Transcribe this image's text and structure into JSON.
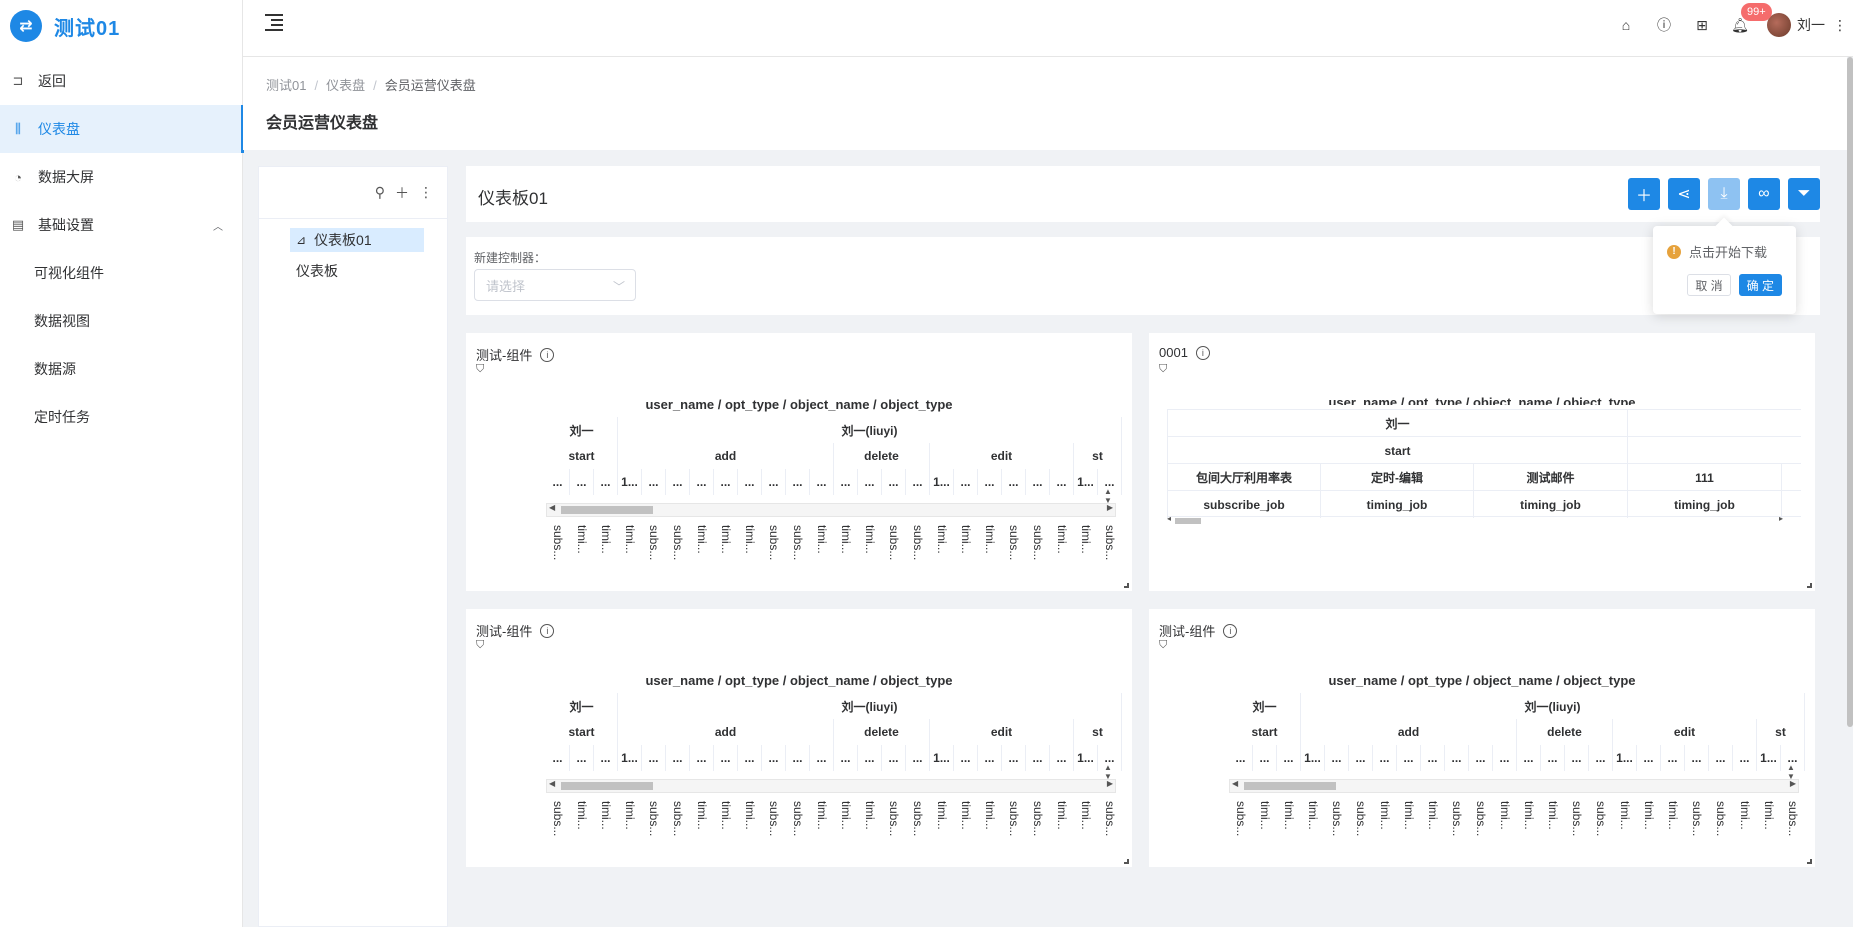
{
  "app": {
    "logo_glyph": "⇄",
    "title": "测试01"
  },
  "sidebar": {
    "items": [
      {
        "label": "返回",
        "icon": "back-icon"
      },
      {
        "label": "仪表盘",
        "icon": "dashboard-icon",
        "active": true
      },
      {
        "label": "数据大屏",
        "icon": "pie-icon"
      },
      {
        "label": "基础设置",
        "icon": "settings-icon",
        "expanded": true
      }
    ],
    "submenu": [
      "可视化组件",
      "数据视图",
      "数据源",
      "定时任务"
    ]
  },
  "header": {
    "badge": "99+",
    "username": "刘一"
  },
  "breadcrumb": [
    "测试01",
    "仪表盘",
    "会员运营仪表盘"
  ],
  "page_title": "会员运营仪表盘",
  "tree": {
    "nodes": [
      "仪表板01",
      "仪表板"
    ]
  },
  "dashboard": {
    "title": "仪表板01",
    "popover": {
      "message": "点击开始下载",
      "cancel": "取 消",
      "confirm": "确 定"
    },
    "control": {
      "label": "新建控制器：",
      "placeholder": "请选择"
    }
  },
  "pivot": {
    "title": "user_name / opt_type / object_name / object_type",
    "row1": [
      "刘一",
      "刘一(liuyi)"
    ],
    "row2": [
      "start",
      "add",
      "delete",
      "edit",
      "st"
    ],
    "dots": [
      "...",
      "...",
      "...",
      "1...",
      "...",
      "...",
      "...",
      "...",
      "...",
      "...",
      "...",
      "...",
      "...",
      "...",
      "...",
      "...",
      "1...",
      "...",
      "...",
      "...",
      "...",
      "...",
      "1...",
      "..."
    ],
    "vlabels": [
      "subs...",
      "timi...",
      "timi...",
      "timi...",
      "subs...",
      "subs...",
      "timi...",
      "timi...",
      "timi...",
      "subs...",
      "subs...",
      "timi...",
      "timi...",
      "timi...",
      "subs...",
      "subs...",
      "timi...",
      "timi...",
      "timi...",
      "subs...",
      "subs...",
      "timi...",
      "timi...",
      "subs..."
    ]
  },
  "widgets": [
    {
      "title": "测试-组件"
    },
    {
      "title": "0001"
    },
    {
      "title": "测试-组件"
    },
    {
      "title": "测试-组件"
    }
  ],
  "table2": {
    "title": "user_name / opt_type / object_name / object_type",
    "row1": "刘一",
    "row2": "start",
    "row3": [
      "包间大厅利用率表",
      "定时-编辑",
      "测试邮件",
      "111"
    ],
    "row4": [
      "subscribe_job",
      "timing_job",
      "timing_job",
      "timing_job"
    ]
  }
}
